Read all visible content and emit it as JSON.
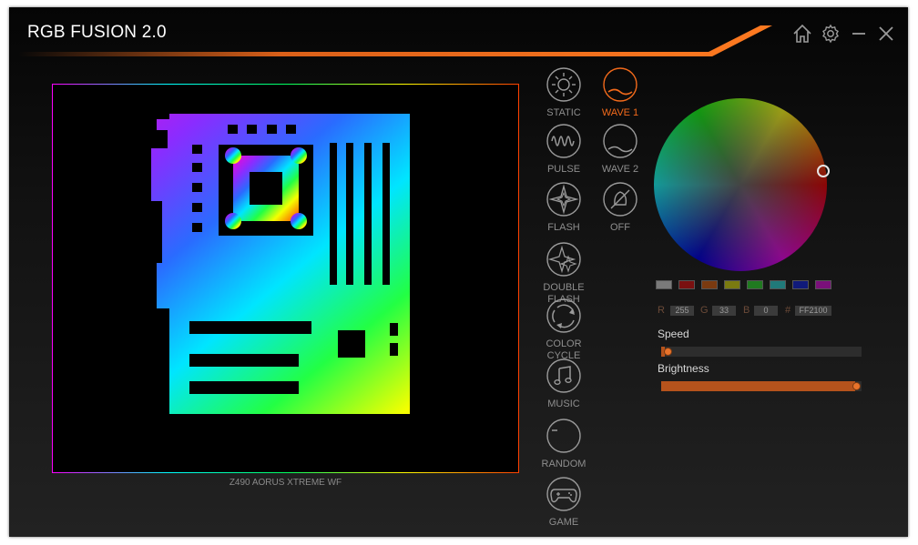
{
  "app": {
    "title": "RGB FUSION 2.0"
  },
  "window_controls": {
    "home": "home-icon",
    "settings": "gear-icon",
    "minimize": "minimize-icon",
    "close": "close-icon"
  },
  "device": {
    "name": "Z490 AORUS XTREME WF"
  },
  "modes": [
    {
      "label": "STATIC",
      "icon": "static-sun-icon",
      "active": false
    },
    {
      "label": "WAVE 1",
      "icon": "wave1-icon",
      "active": true
    },
    {
      "label": "PULSE",
      "icon": "pulse-icon",
      "active": false
    },
    {
      "label": "WAVE 2",
      "icon": "wave2-icon",
      "active": false
    },
    {
      "label": "FLASH",
      "icon": "flash-icon",
      "active": false
    },
    {
      "label": "OFF",
      "icon": "off-icon",
      "active": false
    },
    {
      "label": "DOUBLE\nFLASH",
      "icon": "double-flash-icon",
      "active": false
    },
    {
      "label": "COLOR\nCYCLE",
      "icon": "color-cycle-icon",
      "active": false
    },
    {
      "label": "MUSIC",
      "icon": "music-icon",
      "active": false
    },
    {
      "label": "RANDOM",
      "icon": "random-icon",
      "active": false
    },
    {
      "label": "GAME",
      "icon": "game-controller-icon",
      "active": false
    }
  ],
  "color": {
    "swatches": [
      "#7a7a7a",
      "#7a1010",
      "#7a3a10",
      "#7a7a10",
      "#207a20",
      "#207a7a",
      "#101a7a",
      "#7a107a"
    ],
    "r_label": "R",
    "r": "255",
    "g_label": "G",
    "g": "33",
    "b_label": "B",
    "b": "0",
    "hex_label": "#",
    "hex": "FF2100"
  },
  "speed": {
    "label": "Speed",
    "value": 0.02
  },
  "brightness": {
    "label": "Brightness",
    "value": 0.97
  },
  "colors": {
    "accent": "#f26a1b",
    "text_dim": "#8e8e8e"
  }
}
